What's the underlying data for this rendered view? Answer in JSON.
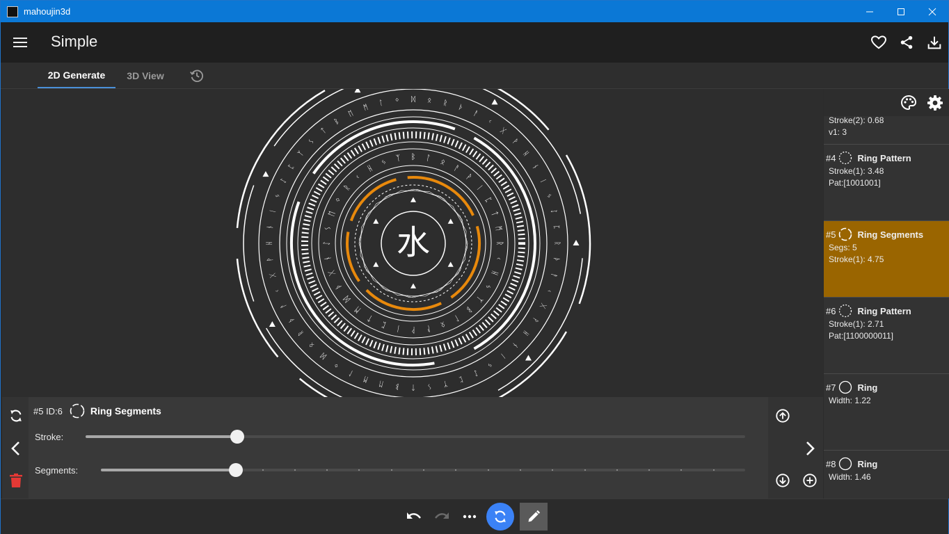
{
  "window": {
    "title": "mahoujin3d",
    "icon": "magic-circle-app-icon"
  },
  "appbar": {
    "title": "Simple",
    "actions": [
      "heart-icon",
      "share-icon",
      "download-icon"
    ]
  },
  "tabs": [
    {
      "label": "2D Generate",
      "active": true
    },
    {
      "label": "3D View",
      "active": false
    }
  ],
  "canvas": {
    "center_glyph": "水",
    "accent": "#e8890c"
  },
  "layers": {
    "partial_top": {
      "lines": [
        "Stroke(2): 0.68",
        "v1: 3"
      ]
    },
    "items": [
      {
        "num": "#4",
        "name": "Ring Pattern",
        "lines": [
          "Stroke(1): 3.48",
          "Pat:[1001001]"
        ],
        "selected": false,
        "icon": "dashed-ring-icon"
      },
      {
        "num": "#5",
        "name": "Ring Segments",
        "lines": [
          "Segs: 5",
          "Stroke(1): 4.75"
        ],
        "selected": true,
        "icon": "segmented-ring-icon"
      },
      {
        "num": "#6",
        "name": "Ring Pattern",
        "lines": [
          "Stroke(1): 2.71",
          "Pat:[1100000011]"
        ],
        "selected": false,
        "icon": "dashed-ring-icon"
      },
      {
        "num": "#7",
        "name": "Ring",
        "lines": [
          "Width: 1.22"
        ],
        "selected": false,
        "icon": "ring-icon"
      },
      {
        "num": "#8",
        "name": "Ring",
        "lines": [
          "Width: 1.46"
        ],
        "selected": false,
        "icon": "ring-icon"
      }
    ],
    "selected_color": "#9a6500"
  },
  "panel": {
    "id_text": "#5 ID:6",
    "name": "Ring Segments",
    "stroke": {
      "label": "Stroke:",
      "fraction": 0.23
    },
    "segments": {
      "label": "Segments:",
      "fraction": 0.21,
      "ticks": 20
    },
    "delete_color": "#e53935"
  },
  "bottombar": {
    "primary_color": "#3b82f6"
  }
}
